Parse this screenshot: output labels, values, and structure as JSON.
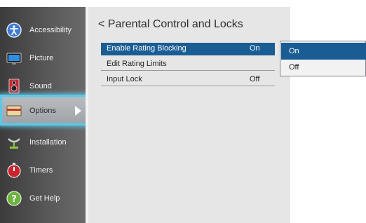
{
  "sidebar": {
    "items": [
      {
        "label": "Accessibility",
        "icon": "accessibility-icon"
      },
      {
        "label": "Picture",
        "icon": "picture-icon"
      },
      {
        "label": "Sound",
        "icon": "sound-icon"
      },
      {
        "label": "Options",
        "icon": "options-icon",
        "active": true
      },
      {
        "label": "Installation",
        "icon": "installation-icon"
      },
      {
        "label": "Timers",
        "icon": "timers-icon"
      },
      {
        "label": "Get Help",
        "icon": "help-icon"
      }
    ]
  },
  "main": {
    "title": "< Parental Control and Locks",
    "rows": [
      {
        "label": "Enable Rating Blocking",
        "value": "On",
        "selected": true
      },
      {
        "label": "Edit Rating Limits",
        "value": ""
      },
      {
        "label": "Input Lock",
        "value": "Off"
      }
    ]
  },
  "popup": {
    "options": [
      {
        "label": "On",
        "selected": true
      },
      {
        "label": "Off",
        "selected": false
      }
    ]
  },
  "colors": {
    "selection": "#1a5d94",
    "focus": "#5ec7e6",
    "panel": "#e6e6e6",
    "sidebar": "#4a4a4a"
  }
}
